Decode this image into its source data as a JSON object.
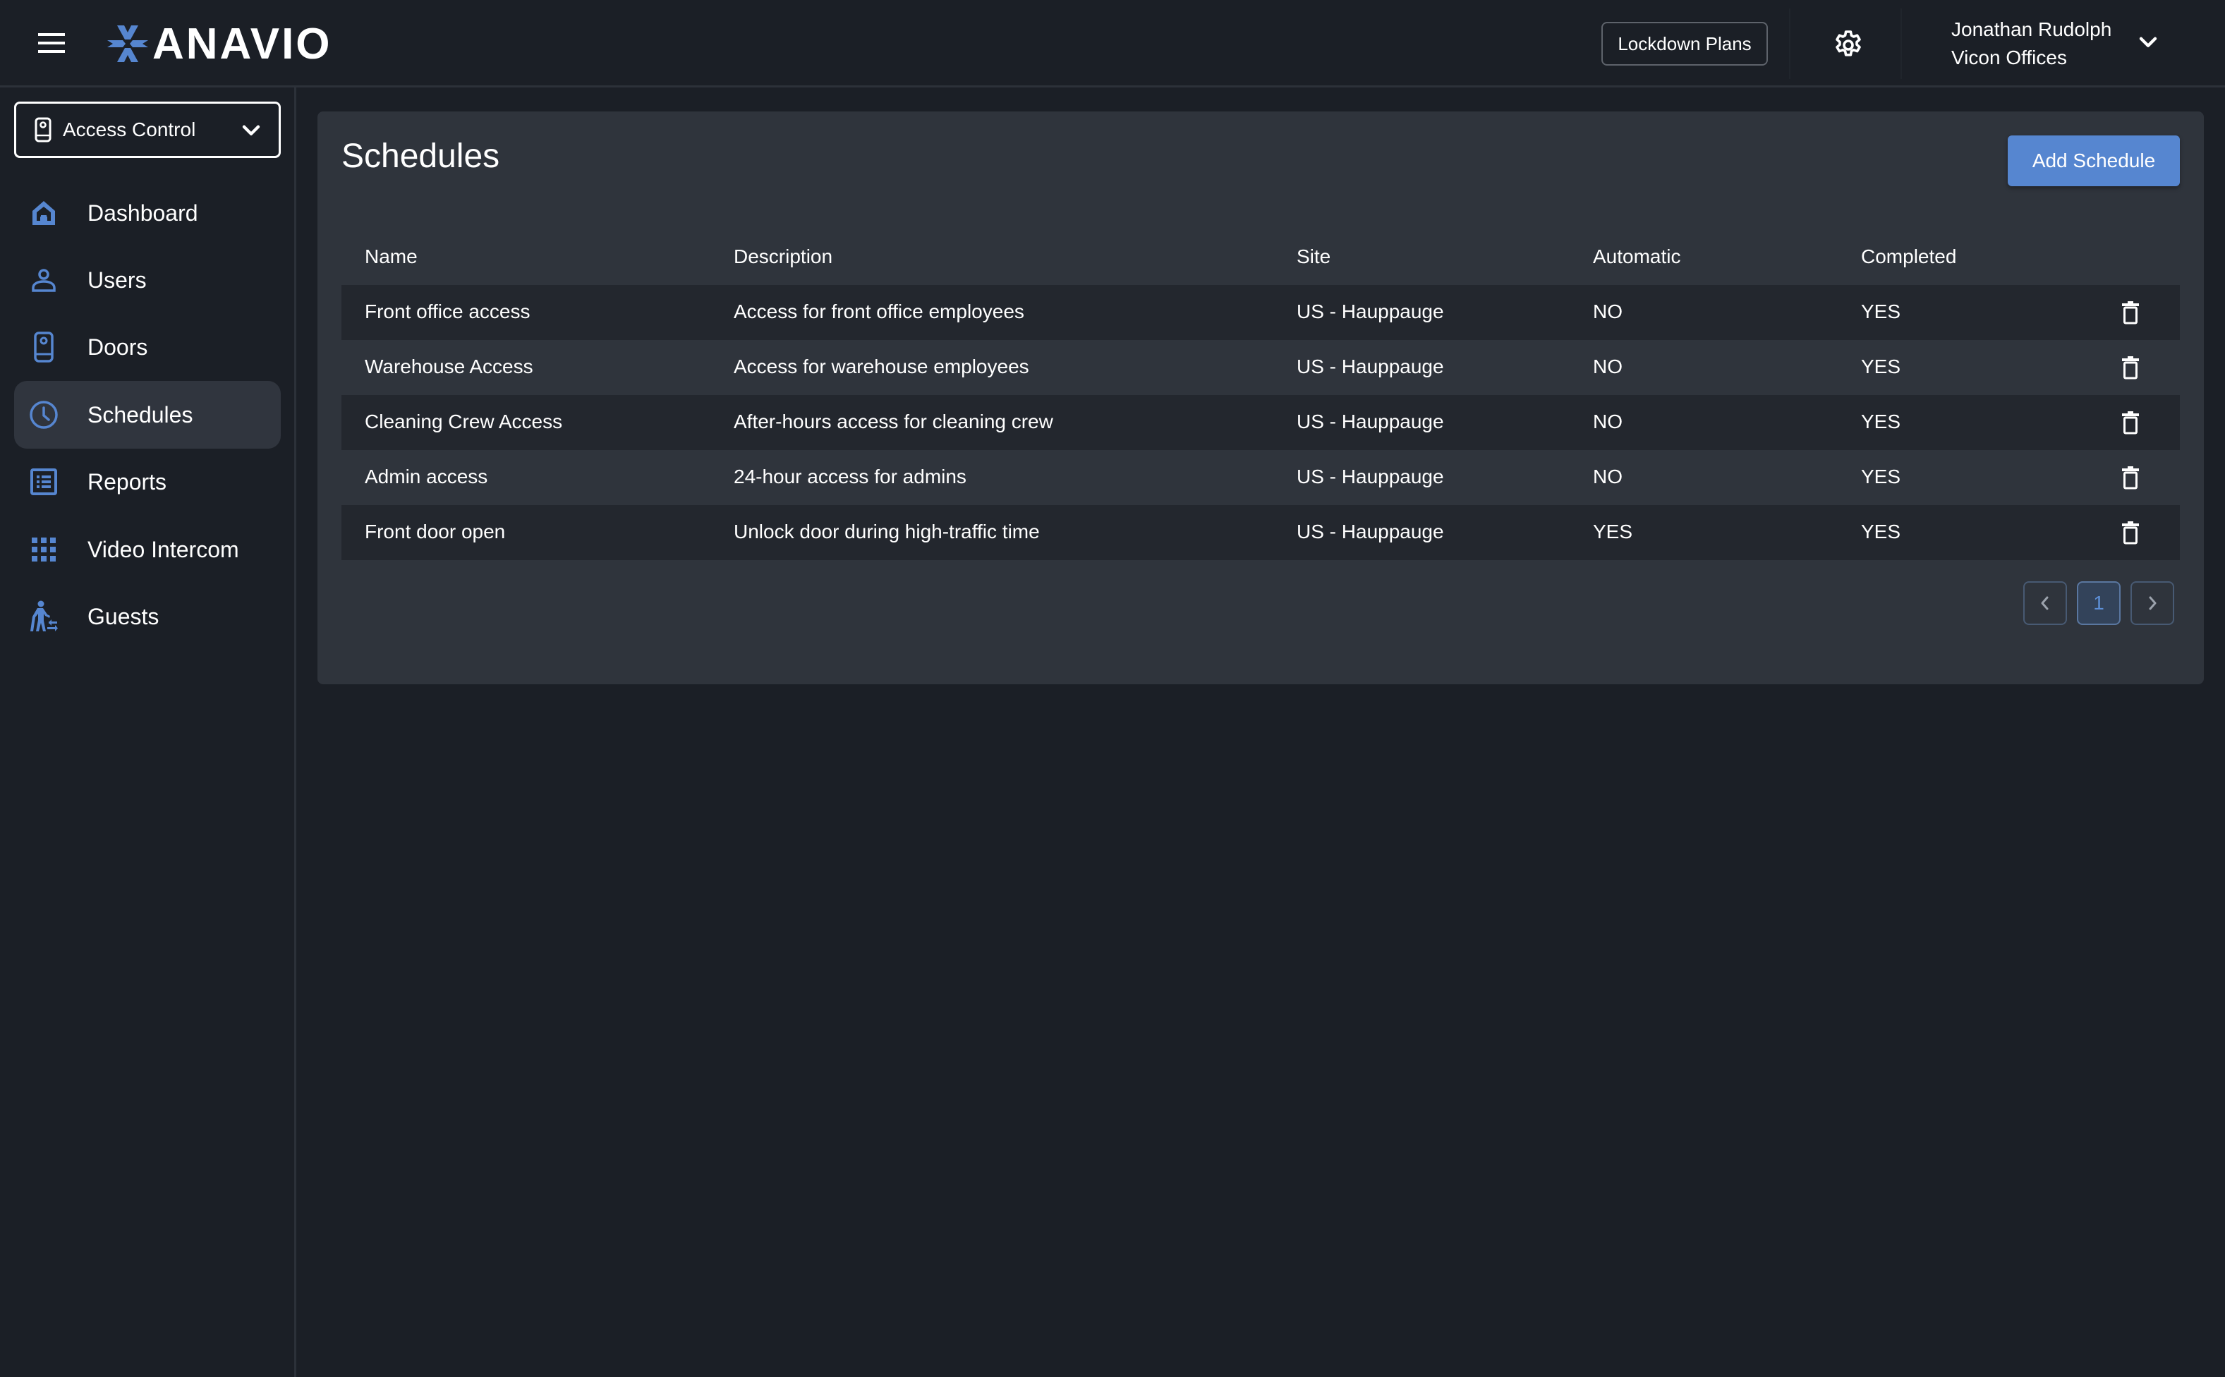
{
  "header": {
    "menu_icon": "hamburger-menu-icon",
    "brand": "ANAVIO",
    "lockdown_label": "Lockdown Plans",
    "settings_icon": "gear-icon",
    "user_name": "Jonathan Rudolph",
    "user_org": "Vicon Offices",
    "user_menu_icon": "chevron-down-icon"
  },
  "sidebar": {
    "module_select": {
      "label": "Access Control",
      "icon": "door-reader-icon"
    },
    "items": [
      {
        "label": "Dashboard",
        "icon": "home-icon",
        "active": false
      },
      {
        "label": "Users",
        "icon": "user-icon",
        "active": false
      },
      {
        "label": "Doors",
        "icon": "door-reader-icon",
        "active": false
      },
      {
        "label": "Schedules",
        "icon": "clock-icon",
        "active": true
      },
      {
        "label": "Reports",
        "icon": "list-report-icon",
        "active": false
      },
      {
        "label": "Video Intercom",
        "icon": "keypad-grid-icon",
        "active": false
      },
      {
        "label": "Guests",
        "icon": "guest-walking-icon",
        "active": false
      }
    ]
  },
  "colors": {
    "accent": "#5686d0",
    "background": "#1b1f26",
    "card": "#2f343c",
    "row_alt": "#23272e"
  },
  "main": {
    "title": "Schedules",
    "add_button": "Add Schedule",
    "table": {
      "columns": [
        "Name",
        "Description",
        "Site",
        "Automatic",
        "Completed"
      ],
      "rows": [
        {
          "name": "Front office access",
          "description": "Access for front office employees",
          "site": "US - Hauppauge",
          "automatic": "NO",
          "completed": "YES"
        },
        {
          "name": "Warehouse Access",
          "description": "Access for warehouse employees",
          "site": "US - Hauppauge",
          "automatic": "NO",
          "completed": "YES"
        },
        {
          "name": "Cleaning Crew Access",
          "description": "After-hours access for cleaning crew",
          "site": "US - Hauppauge",
          "automatic": "NO",
          "completed": "YES"
        },
        {
          "name": "Admin access",
          "description": "24-hour access for admins",
          "site": "US - Hauppauge",
          "automatic": "NO",
          "completed": "YES"
        },
        {
          "name": "Front door open",
          "description": "Unlock door during high-traffic time",
          "site": "US - Hauppauge",
          "automatic": "YES",
          "completed": "YES"
        }
      ],
      "row_action_icon": "trash-icon"
    },
    "pagination": {
      "prev_icon": "chevron-left-icon",
      "current_page": "1",
      "next_icon": "chevron-right-icon"
    }
  }
}
